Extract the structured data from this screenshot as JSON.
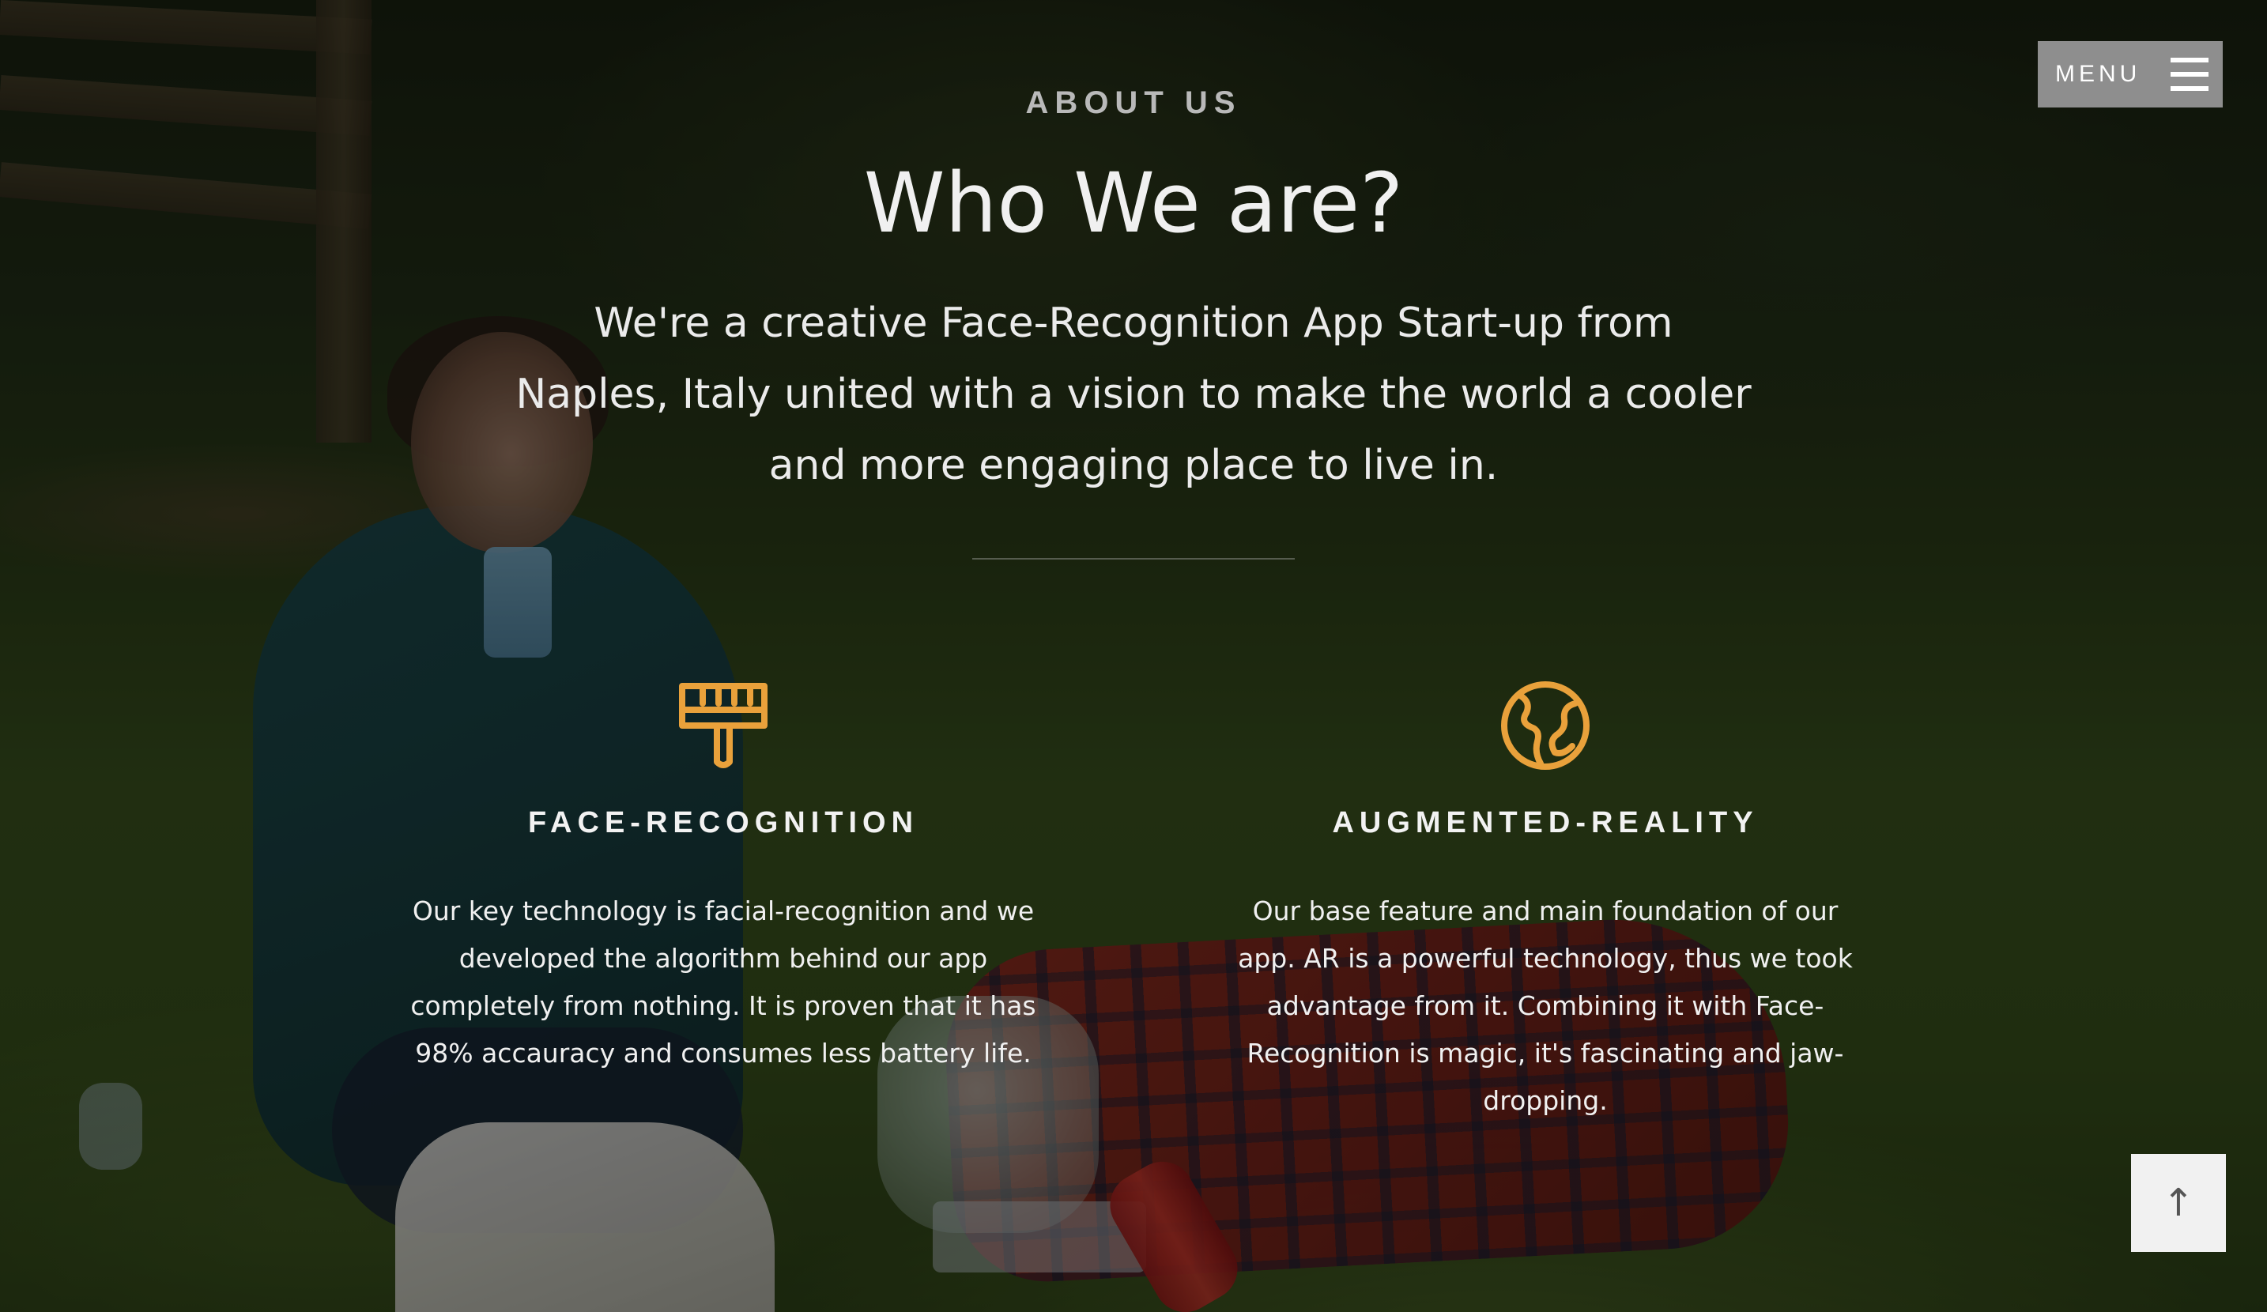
{
  "menu": {
    "label": "MENU",
    "icon": "hamburger-icon"
  },
  "about": {
    "eyebrow": "ABOUT US",
    "title": "Who We are?",
    "intro": "We're a creative Face-Recognition App Start-up from Naples, Italy united with a vision to make the world a cooler and more engaging place to live in."
  },
  "features": [
    {
      "icon": "paintbrush-icon",
      "title": "FACE-RECOGNITION",
      "text": "Our key technology is facial-recognition and we developed the algorithm behind our app completely from nothing. It is proven that it has 98% accauracy and consumes less battery life."
    },
    {
      "icon": "globe-icon",
      "title": "AUGMENTED-REALITY",
      "text": "Our base feature and main foundation of our app. AR is a powerful technology, thus we took advantage from it. Combining it with Face-Recognition is magic, it's fascinating and jaw-dropping."
    }
  ],
  "scroll_top": {
    "icon": "arrow-up-icon",
    "glyph": "↑"
  },
  "colors": {
    "accent": "#e9a13b",
    "menu_bg": "#8e8e8e",
    "eyebrow": "#b9b9b9"
  }
}
